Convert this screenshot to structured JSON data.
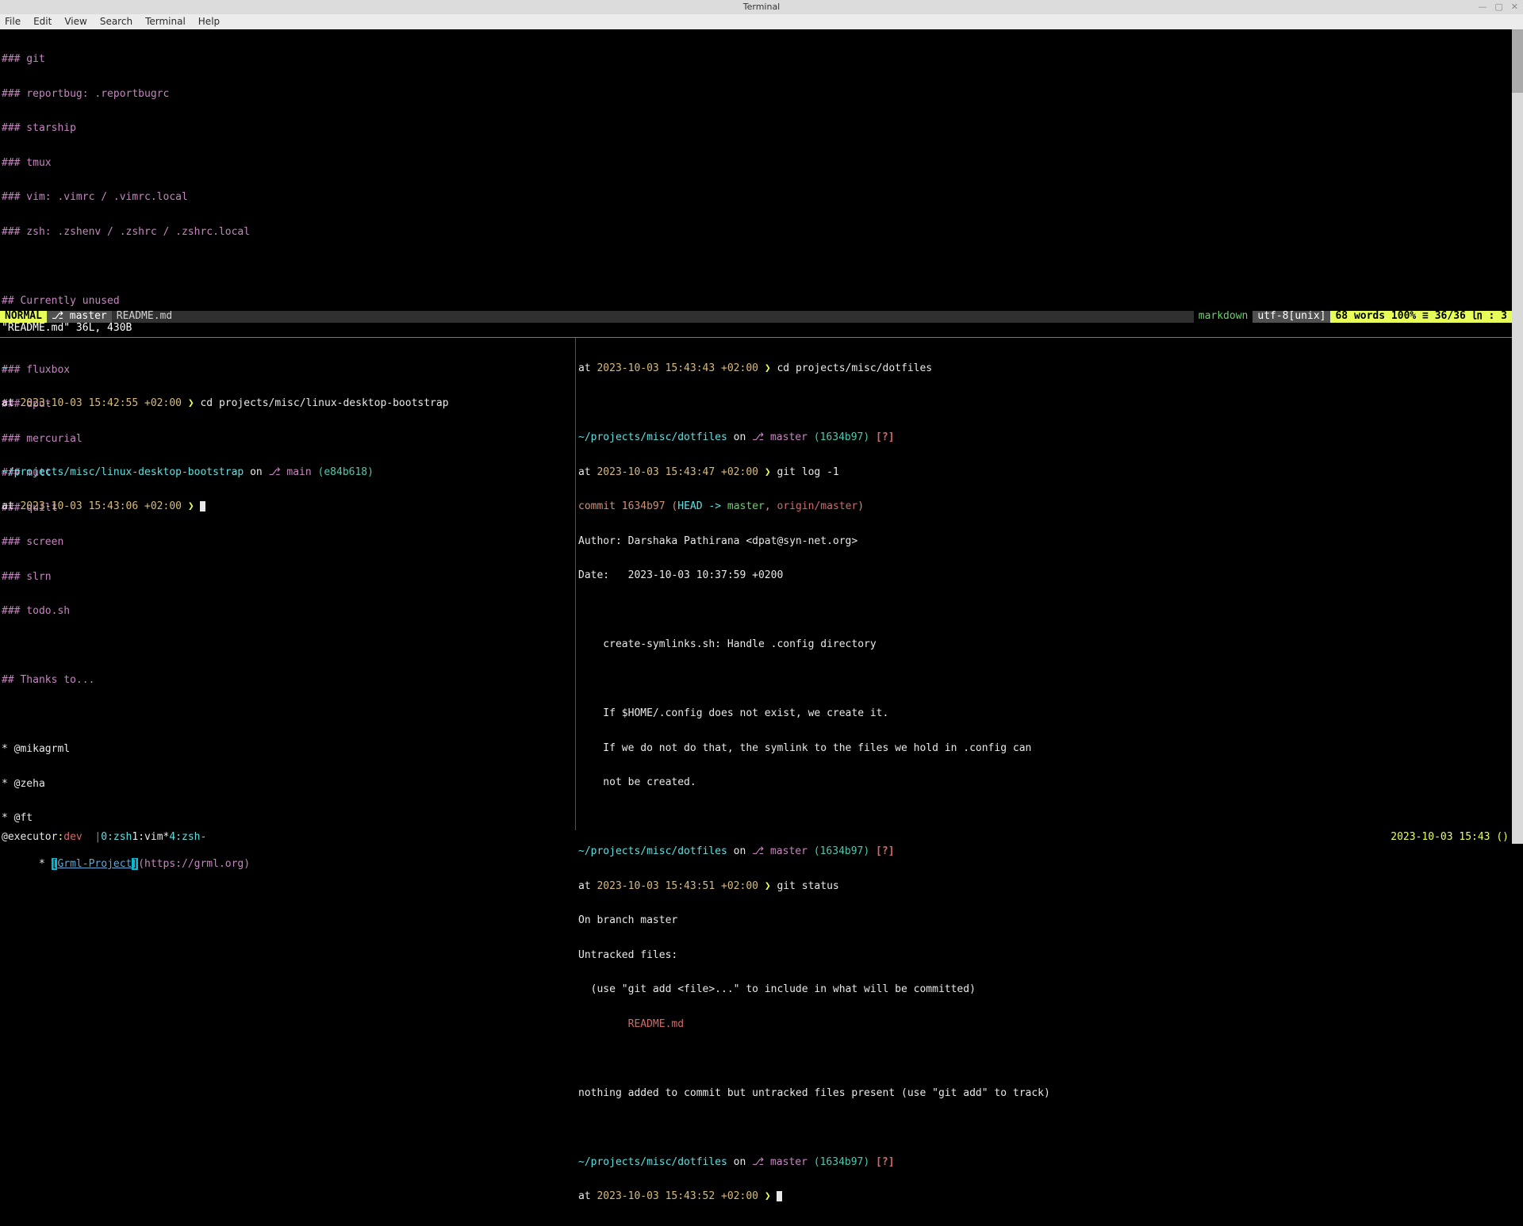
{
  "window": {
    "title": "Terminal",
    "menu": [
      "File",
      "Edit",
      "View",
      "Search",
      "Terminal",
      "Help"
    ],
    "controls": {
      "min": "—",
      "max": "▢",
      "close": "✕"
    }
  },
  "vim": {
    "lines": {
      "l0": "### git",
      "l1": "### reportbug: .reportbugrc",
      "l2": "### starship",
      "l3": "### tmux",
      "l4": "### vim: .vimrc / .vimrc.local",
      "l5": "### zsh: .zshenv / .zshrc / .zshrc.local",
      "l6": "",
      "l7": "## Currently unused",
      "l8": "",
      "l9": "### fluxbox",
      "l10": "### dput",
      "l11": "### mercurial",
      "l12": "### mutt",
      "l13": "### quilt",
      "l14": "### screen",
      "l15": "### slrn",
      "l16": "### todo.sh",
      "l17": "",
      "l18": "## Thanks to...",
      "l19": "",
      "l20": "* @mikagrml",
      "l21": "* @zeha",
      "l22": "* @ft",
      "l23_pre": "* ",
      "l23_lb": "[",
      "l23_link": "Grml-Project",
      "l23_rb": "]",
      "l23_url": "(https://grml.org)"
    },
    "status": {
      "mode": " NORMAL ",
      "branch": " master",
      "file": "README.md",
      "filetype": "markdown",
      "encoding": "utf-8[unix]",
      "words": "68 words",
      "percent": "100% ≡",
      "pos": "36/36 ㏑ :  3"
    },
    "msgline": "\"README.md\" 36L, 430B"
  },
  "left_pane": {
    "tilde": "~",
    "ts1": "2023-10-03 15:42:55 +02:00",
    "cmd1": "cd projects/misc/linux-desktop-bootstrap",
    "path2": "~/projects/misc/linux-desktop-bootstrap",
    "on": " on ",
    "branch2": " main",
    "hash2": " (e84b618)",
    "ts3": "2023-10-03 15:43:06 +02:00"
  },
  "right_pane": {
    "ts0": "2023-10-03 15:43:43 +02:00",
    "cmd0": "cd projects/misc/dotfiles",
    "path": "~/projects/misc/dotfiles",
    "on": " on ",
    "branch": " master",
    "hash": " (1634b97)",
    "flag": " [?]",
    "ts1": "2023-10-03 15:43:47 +02:00",
    "cmd1": "git log -1",
    "commit_word": "commit ",
    "commit_hash": "1634b97",
    "head_open": " (",
    "head_ref": "HEAD -> ",
    "head_master": "master",
    "head_sep": ", ",
    "head_origin": "origin/master",
    "head_close": ")",
    "author": "Author: Darshaka Pathirana <dpat@syn-net.org>",
    "date": "Date:   2023-10-03 10:37:59 +0200",
    "msg1": "    create-symlinks.sh: Handle .config directory",
    "msg2": "    If $HOME/.config does not exist, we create it.",
    "msg3": "    If we do not do that, the symlink to the files we hold in .config can",
    "msg4": "    not be created.",
    "ts2": "2023-10-03 15:43:51 +02:00",
    "cmd2": "git status",
    "gs1": "On branch master",
    "gs2": "Untracked files:",
    "gs3": "  (use \"git add <file>...\" to include in what will be committed)",
    "gs4": "        README.md",
    "gs5": "nothing added to commit but untracked files present (use \"git add\" to track)",
    "ts3": "2023-10-03 15:43:52 +02:00"
  },
  "tmux": {
    "host_user": "@executor",
    "host_sep": ":",
    "host_env": "dev",
    "pipe": "  |",
    "win0": "0:zsh",
    "win1": "1:vim*",
    "win4": "4:zsh-",
    "clock": "2023-10-03 15:43 ()"
  }
}
